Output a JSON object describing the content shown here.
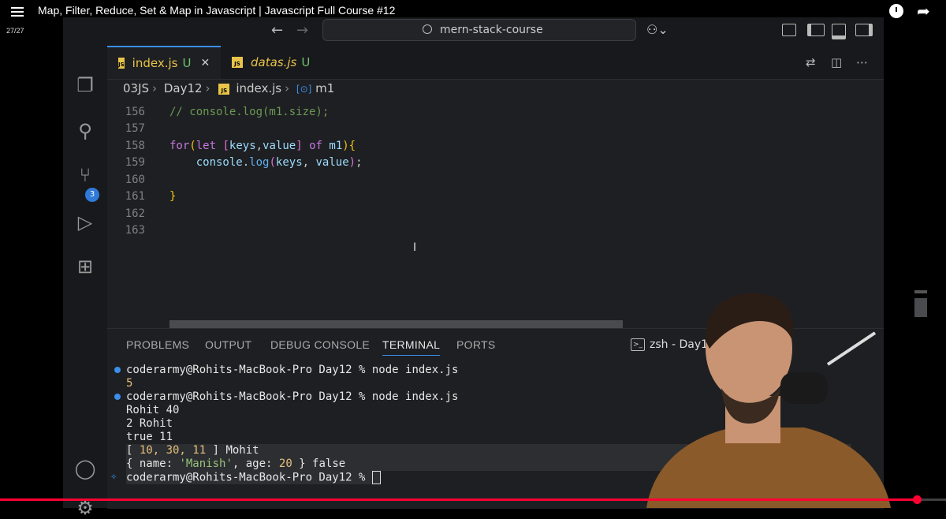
{
  "video": {
    "title": "Map, Filter, Reduce, Set & Map in Javascript | Javascript Full Course #12",
    "playlist_position": "27/27",
    "progress": 0.97
  },
  "window": {
    "search_label": "mern-stack-course"
  },
  "activity_bar": {
    "source_control_badge": "3"
  },
  "tabs": [
    {
      "name": "index.js",
      "status": "U",
      "active": true
    },
    {
      "name": "datas.js",
      "status": "U",
      "active": false
    }
  ],
  "breadcrumb": {
    "items": [
      "03JS",
      "Day12",
      "index.js",
      "m1"
    ]
  },
  "editor": {
    "lines": [
      {
        "num": "156",
        "text": "// console.log(m1.size);"
      },
      {
        "num": "157",
        "text": ""
      },
      {
        "num": "158",
        "text": "for(let [keys,value] of m1){"
      },
      {
        "num": "159",
        "text": "    console.log(keys, value);"
      },
      {
        "num": "160",
        "text": ""
      },
      {
        "num": "161",
        "text": "}"
      },
      {
        "num": "162",
        "text": ""
      },
      {
        "num": "163",
        "text": ""
      }
    ]
  },
  "panel": {
    "tabs": [
      "PROBLEMS",
      "OUTPUT",
      "DEBUG CONSOLE",
      "TERMINAL",
      "PORTS"
    ],
    "active_tab": "TERMINAL",
    "terminal_name": "zsh - Day12"
  },
  "terminal": {
    "prompt": "coderarmy@Rohits-MacBook-Pro Day12 %",
    "cmd1": "node index.js",
    "out1": "5",
    "cmd2": "node index.js",
    "out_lines": [
      "Rohit 40",
      "2 Rohit",
      "true 11"
    ],
    "arr_open": "[ ",
    "arr_vals": "10, 30, 11",
    "arr_close": " ] Mohit",
    "obj_open": "{ name: ",
    "obj_name": "'Manish'",
    "obj_mid": ", age: ",
    "obj_age": "20",
    "obj_close": " } false"
  },
  "colors": {
    "accent": "#3b8eea",
    "js_badge": "#e8c44a",
    "untracked": "#6cc36c",
    "progress": "#ff0033"
  }
}
